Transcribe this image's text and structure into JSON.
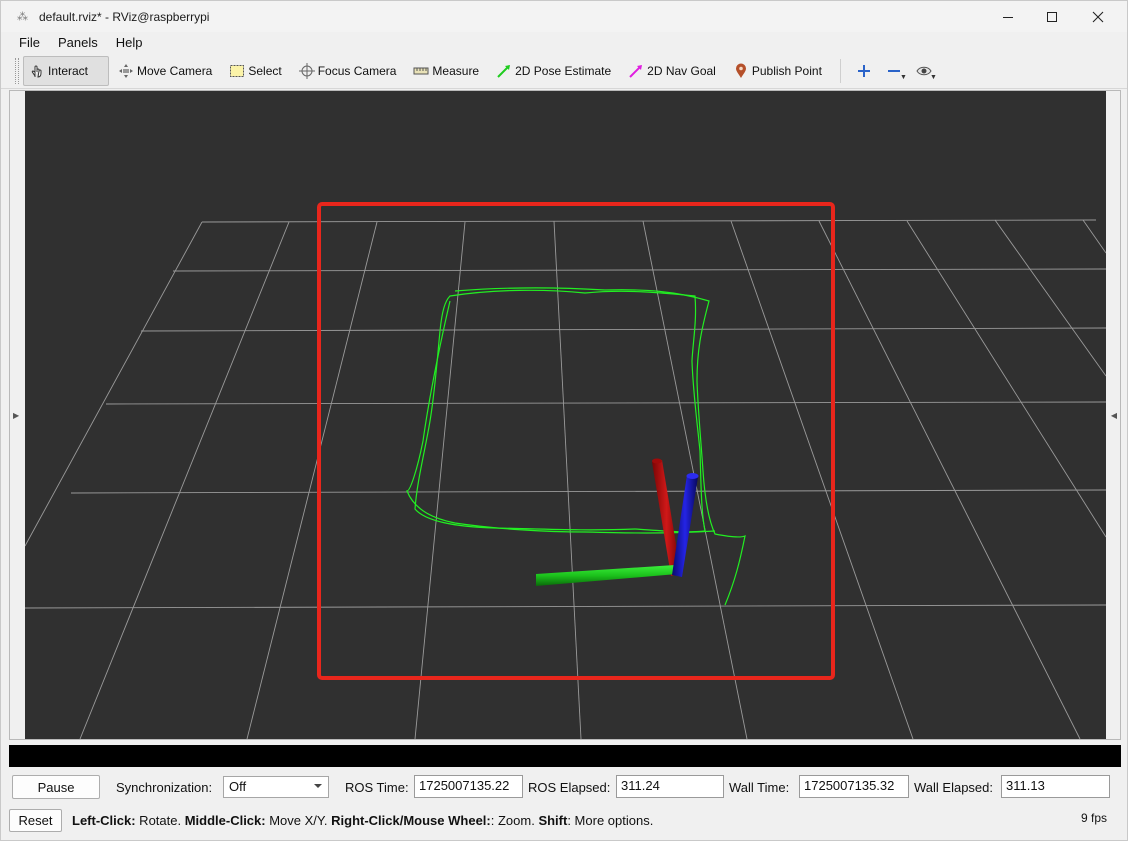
{
  "window": {
    "title": "default.rviz* - RViz@raspberrypi"
  },
  "menu": [
    "File",
    "Panels",
    "Help"
  ],
  "toolbar": {
    "tools": [
      {
        "label": "Interact",
        "icon": "hand-pointer-icon",
        "active": true
      },
      {
        "label": "Move Camera",
        "icon": "move-camera-icon",
        "active": false
      },
      {
        "label": "Select",
        "icon": "select-rectangle-icon",
        "active": false
      },
      {
        "label": "Focus Camera",
        "icon": "focus-crosshair-icon",
        "active": false
      },
      {
        "label": "Measure",
        "icon": "ruler-icon",
        "active": false
      },
      {
        "label": "2D Pose Estimate",
        "icon": "green-arrow-icon",
        "active": false
      },
      {
        "label": "2D Nav Goal",
        "icon": "magenta-arrow-icon",
        "active": false
      },
      {
        "label": "Publish Point",
        "icon": "map-pin-icon",
        "active": false
      }
    ],
    "extra": [
      "add-tool-icon",
      "remove-tool-icon",
      "eye-icon"
    ]
  },
  "colors": {
    "background": "#303030",
    "grid": "#a0a0a0",
    "path": "#22ee22",
    "highlight_box": "#e8261c",
    "x_axis": "#cc1010",
    "y_axis": "#22dd22",
    "z_axis": "#1818dd"
  },
  "time": {
    "pause_label": "Pause",
    "sync_label": "Synchronization:",
    "sync_value": "Off",
    "ros_time_label": "ROS Time:",
    "ros_time": "1725007135.22",
    "ros_elapsed_label": "ROS Elapsed:",
    "ros_elapsed": "311.24",
    "wall_time_label": "Wall Time:",
    "wall_time": "1725007135.32",
    "wall_elapsed_label": "Wall Elapsed:",
    "wall_elapsed": "311.13"
  },
  "status": {
    "reset_label": "Reset",
    "help_parts": [
      {
        "b": "Left-Click:",
        "t": " Rotate. "
      },
      {
        "b": "Middle-Click:",
        "t": " Move X/Y. "
      },
      {
        "b": "Right-Click/Mouse Wheel:",
        "t": ": Zoom. "
      },
      {
        "b": "Shift",
        "t": ": More options."
      }
    ],
    "fps": "9 fps"
  }
}
